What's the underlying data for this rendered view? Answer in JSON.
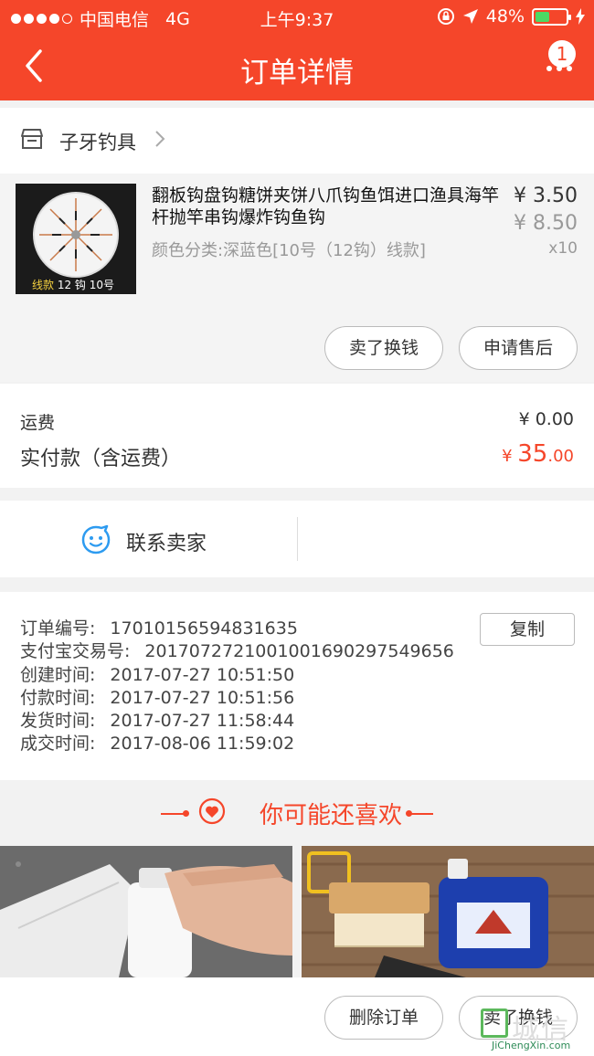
{
  "status_bar": {
    "carrier": "中国电信",
    "network": "4G",
    "time": "上午9:37",
    "battery": "48%",
    "battery_level": 0.48
  },
  "nav": {
    "title": "订单详情",
    "badge": "1"
  },
  "shop": {
    "name": "子牙钓具"
  },
  "item": {
    "title": "翻板钩盘钩糖饼夹饼八爪钩鱼饵进口渔具海竿杆抛竿串钩爆炸钩鱼钩",
    "sku": "颜色分类:深蓝色[10号（12钩）线款]",
    "price": "¥ 3.50",
    "original_price": "¥ 8.50",
    "quantity": "x10",
    "thumb_caption_highlight": "线款",
    "thumb_caption_rest": "12 钩 10号",
    "btn_sell": "卖了换钱",
    "btn_after_sale": "申请售后"
  },
  "fees": {
    "shipping_label": "运费",
    "shipping_value": "¥ 0.00",
    "paid_label": "实付款（含运费）",
    "paid_currency": "¥ ",
    "paid_int": "35",
    "paid_dec": ".00"
  },
  "contact": {
    "label": "联系卖家"
  },
  "order": {
    "copy_label": "复制",
    "rows": [
      {
        "label": "订单编号:",
        "value": "17010156594831635"
      },
      {
        "label": "支付宝交易号:",
        "value": "2017072721001001690297549656"
      },
      {
        "label": "创建时间:",
        "value": "2017-07-27 10:51:50"
      },
      {
        "label": "付款时间:",
        "value": "2017-07-27 10:51:56"
      },
      {
        "label": "发货时间:",
        "value": "2017-07-27 11:58:44"
      },
      {
        "label": "成交时间:",
        "value": "2017-08-06 11:59:02"
      }
    ]
  },
  "recommend": {
    "title": "你可能还喜欢"
  },
  "footer": {
    "btn_delete": "删除订单",
    "btn_sell": "卖了换钱"
  },
  "watermark": {
    "url": "JiChengXin.com"
  },
  "colors": {
    "brand": "#f5462a",
    "battery": "#4cd964",
    "contact_icon": "#2d9bf0"
  }
}
